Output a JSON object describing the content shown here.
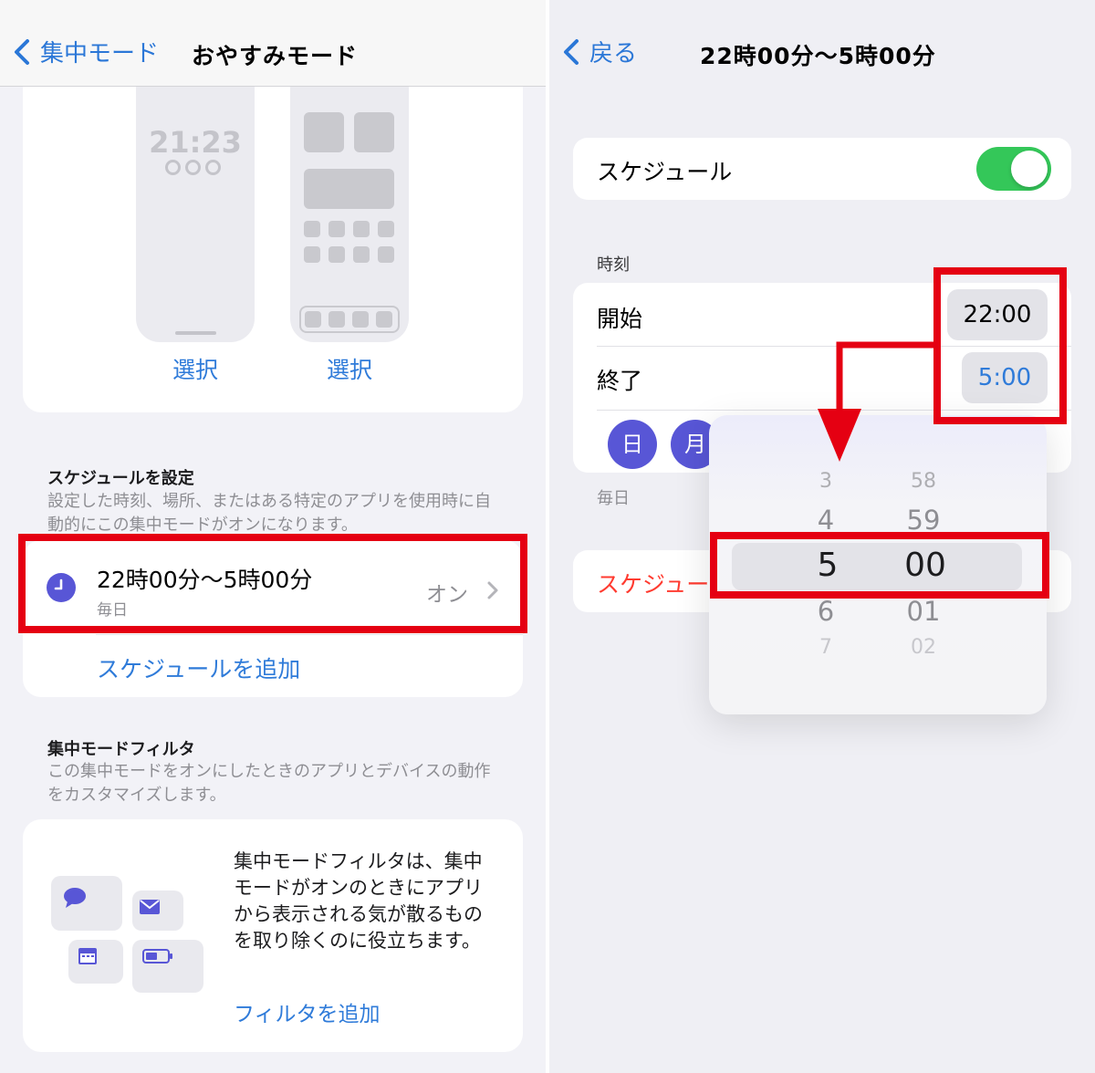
{
  "left": {
    "nav": {
      "back_label": "集中モード",
      "title": "おやすみモード"
    },
    "preview": {
      "lock_clock": "21:23",
      "select_lock": "選択",
      "select_home": "選択"
    },
    "schedule_section": {
      "heading": "スケジュールを設定",
      "description": "設定した時刻、場所、またはある特定のアプリを使用時に自動的にこの集中モードがオンになります。",
      "item": {
        "title": "22時00分〜5時00分",
        "subtitle": "毎日",
        "status": "オン"
      },
      "add_label": "スケジュールを追加"
    },
    "filter_section": {
      "heading": "集中モードフィルタ",
      "description": "この集中モードをオンにしたときのアプリとデバイスの動作をカスタマイズします。",
      "card_text": "集中モードフィルタは、集中モードがオンのときにアプリから表示される気が散るものを取り除くのに役立ちます。",
      "add_label": "フィルタを追加"
    }
  },
  "right": {
    "nav": {
      "back_label": "戻る",
      "title": "22時00分〜5時00分"
    },
    "schedule_label": "スケジュール",
    "schedule_on": true,
    "time_section_label": "時刻",
    "start_label": "開始",
    "start_time": "22:00",
    "end_label": "終了",
    "end_time": "5:00",
    "days": [
      "日",
      "月"
    ],
    "repeat_label": "毎日",
    "delete_label": "スケジュー",
    "picker": {
      "hours": [
        "3",
        "4",
        "5",
        "6",
        "7"
      ],
      "minutes": [
        "58",
        "59",
        "00",
        "01",
        "02"
      ],
      "selected_hour": "5",
      "selected_minute": "00"
    }
  },
  "colors": {
    "accent_blue": "#2f7bd9",
    "highlight_red": "#e50012",
    "focus_purple": "#5856d6",
    "toggle_green": "#34c759",
    "destructive_red": "#ff3b30"
  }
}
